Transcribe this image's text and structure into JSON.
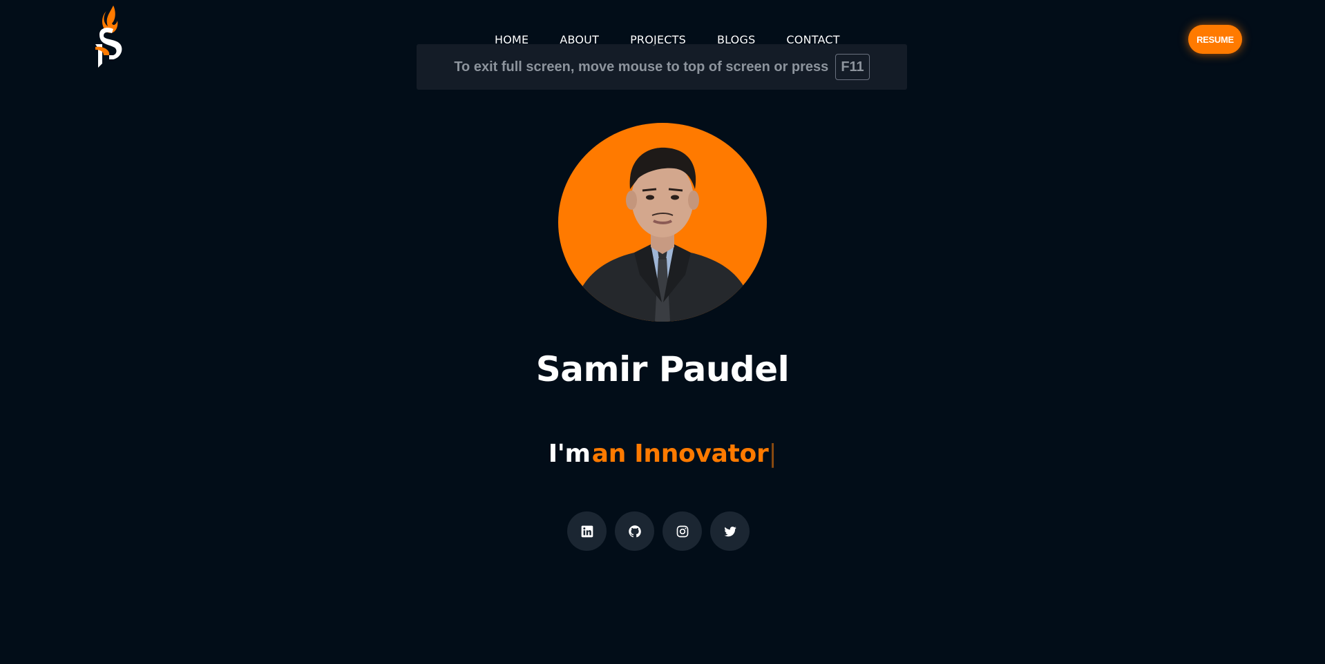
{
  "brand": {
    "logo_icon": "sp-flame-logo-icon"
  },
  "nav": {
    "items": [
      {
        "label": "HOME"
      },
      {
        "label": "ABOUT"
      },
      {
        "label": "PROJECTS"
      },
      {
        "label": "BLOGS"
      },
      {
        "label": "CONTACT"
      }
    ],
    "resume_label": "RESUME"
  },
  "fullscreen_notice": {
    "message": "To exit full screen, move mouse to top of screen or press",
    "key": "F11"
  },
  "hero": {
    "name": "Samir Paudel",
    "intro": "I'm",
    "role": "an Innovator",
    "cursor": "|"
  },
  "social": [
    {
      "icon": "linkedin-icon"
    },
    {
      "icon": "github-icon"
    },
    {
      "icon": "instagram-icon"
    },
    {
      "icon": "twitter-icon"
    }
  ],
  "colors": {
    "background": "#020d18",
    "accent": "#ff7a00",
    "social_button": "#1b2632"
  }
}
